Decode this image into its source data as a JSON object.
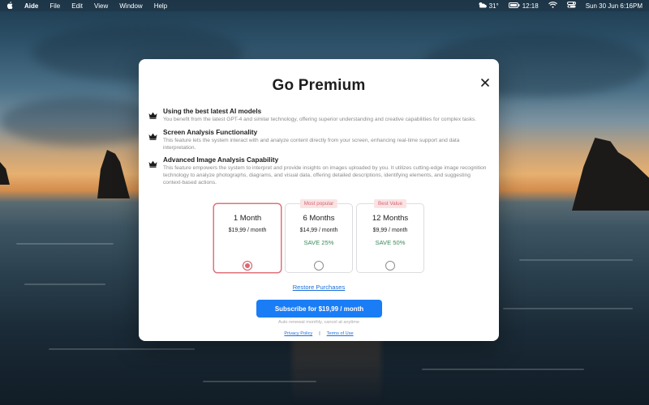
{
  "menubar": {
    "app_name": "Aide",
    "menus": [
      "File",
      "Edit",
      "View",
      "Window",
      "Help"
    ],
    "weather": "31°",
    "clock_small": "12:18",
    "datetime": "Sun 30 Jun  6:16PM",
    "icons": [
      "apple-icon",
      "weather-icon",
      "battery-icon",
      "wifi-icon",
      "control-center-icon"
    ]
  },
  "modal": {
    "title": "Go Premium",
    "features": [
      {
        "title": "Using the best latest AI models",
        "description": "You benefit from the latest GPT-4 and similar technology, offering superior understanding and creative capabilities for complex tasks."
      },
      {
        "title": "Screen Analysis Functionality",
        "description": "This feature lets the system interact with and analyze content directly from your screen, enhancing real-time support and data interpretation."
      },
      {
        "title": "Advanced Image Analysis Capability",
        "description": "This feature empowers the system to interpret and provide insights on images uploaded by you. It utilizes cutting-edge image recognition technology to analyze photographs, diagrams, and visual data, offering detailed descriptions, identifying elements, and suggesting context-based actions."
      }
    ],
    "plans": [
      {
        "tag": "",
        "name": "1 Month",
        "price": "$19,99 / month",
        "save": "",
        "selected": true
      },
      {
        "tag": "Most popular",
        "name": "6 Months",
        "price": "$14,99 / month",
        "save": "SAVE 25%",
        "selected": false
      },
      {
        "tag": "Best Value",
        "name": "12 Months",
        "price": "$9,99 / month",
        "save": "SAVE 50%",
        "selected": false
      }
    ],
    "restore_label": "Restore Purchases",
    "subscribe_label": "Subscribe for $19,99 / month",
    "renewal_note": "Auto renewal monthly, cancel at anytime",
    "privacy_label": "Privacy Policy",
    "separator": "|",
    "terms_label": "Terms of Use"
  },
  "colors": {
    "accent_blue": "#1a7df5",
    "selected_border": "#e0717a",
    "save_green": "#3a8a5a",
    "tag_bg": "#fbe3e4"
  }
}
